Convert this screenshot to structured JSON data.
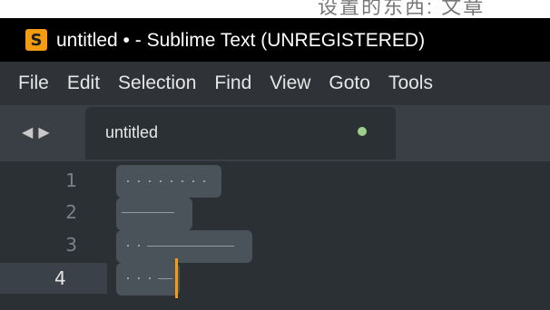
{
  "window": {
    "title": "untitled • - Sublime Text (UNREGISTERED)",
    "app_icon_glyph": "S",
    "background_overlay_text": "设置的东西: 文章"
  },
  "menu": {
    "items": [
      {
        "label": "File"
      },
      {
        "label": "Edit"
      },
      {
        "label": "Selection"
      },
      {
        "label": "Find"
      },
      {
        "label": "View"
      },
      {
        "label": "Goto"
      },
      {
        "label": "Tools"
      }
    ]
  },
  "tabbar": {
    "nav_left_icon": "◀",
    "nav_right_icon": "▶",
    "tab_title": "untitled",
    "tab_modified_indicator_color": "#9bcf8a"
  },
  "editor": {
    "line_numbers": [
      "1",
      "2",
      "3",
      "4"
    ],
    "current_line": "4",
    "theme": {
      "background": "#2b3035",
      "gutter_text": "#7a8087",
      "current_line_bg": "#3b4148",
      "caret": "#f39c12"
    }
  }
}
